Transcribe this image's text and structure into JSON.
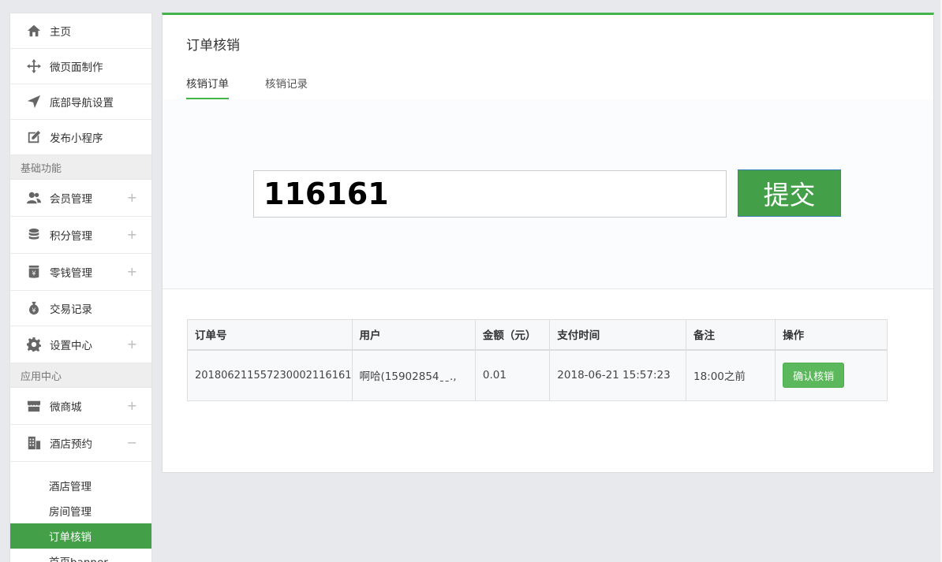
{
  "sidebar": {
    "top_items": [
      {
        "label": "主页",
        "icon": "home-icon"
      },
      {
        "label": "微页面制作",
        "icon": "move-icon"
      },
      {
        "label": "底部导航设置",
        "icon": "navigation-arrow-icon"
      },
      {
        "label": "发布小程序",
        "icon": "edit-icon"
      }
    ],
    "section_basic": "基础功能",
    "basic_items": [
      {
        "label": "会员管理",
        "icon": "users-icon",
        "expander": "+"
      },
      {
        "label": "积分管理",
        "icon": "database-icon",
        "expander": "+"
      },
      {
        "label": "零钱管理",
        "icon": "wallet-icon",
        "expander": "+"
      },
      {
        "label": "交易记录",
        "icon": "money-bag-icon",
        "expander": ""
      },
      {
        "label": "设置中心",
        "icon": "gear-icon",
        "expander": "+"
      }
    ],
    "section_app": "应用中心",
    "app_items": [
      {
        "label": "微商城",
        "icon": "store-icon",
        "expander": "+"
      },
      {
        "label": "酒店预约",
        "icon": "building-icon",
        "expander": "−"
      }
    ],
    "sub_items": [
      {
        "label": "酒店管理",
        "active": false
      },
      {
        "label": "房间管理",
        "active": false
      },
      {
        "label": "订单核销",
        "active": true
      },
      {
        "label": "首页banner",
        "active": false
      }
    ]
  },
  "main": {
    "title": "订单核销",
    "tabs": [
      "核销订单",
      "核销记录"
    ],
    "code_value": "116161",
    "submit_label": "提交",
    "table": {
      "headers": [
        "订单号",
        "用户",
        "金额（元）",
        "支付时间",
        "备注",
        "操作"
      ],
      "rows": [
        {
          "order_no": "201806211557230002116161",
          "user": "啊哈(15902854ˍˍ.,",
          "amount": "0.01",
          "pay_time": "2018-06-21 15:57:23",
          "note": "18:00之前",
          "action": "确认核销"
        }
      ]
    }
  },
  "colors": {
    "accent": "#44b34a",
    "active_bg": "#44a048",
    "button_green": "#5cb85c"
  }
}
